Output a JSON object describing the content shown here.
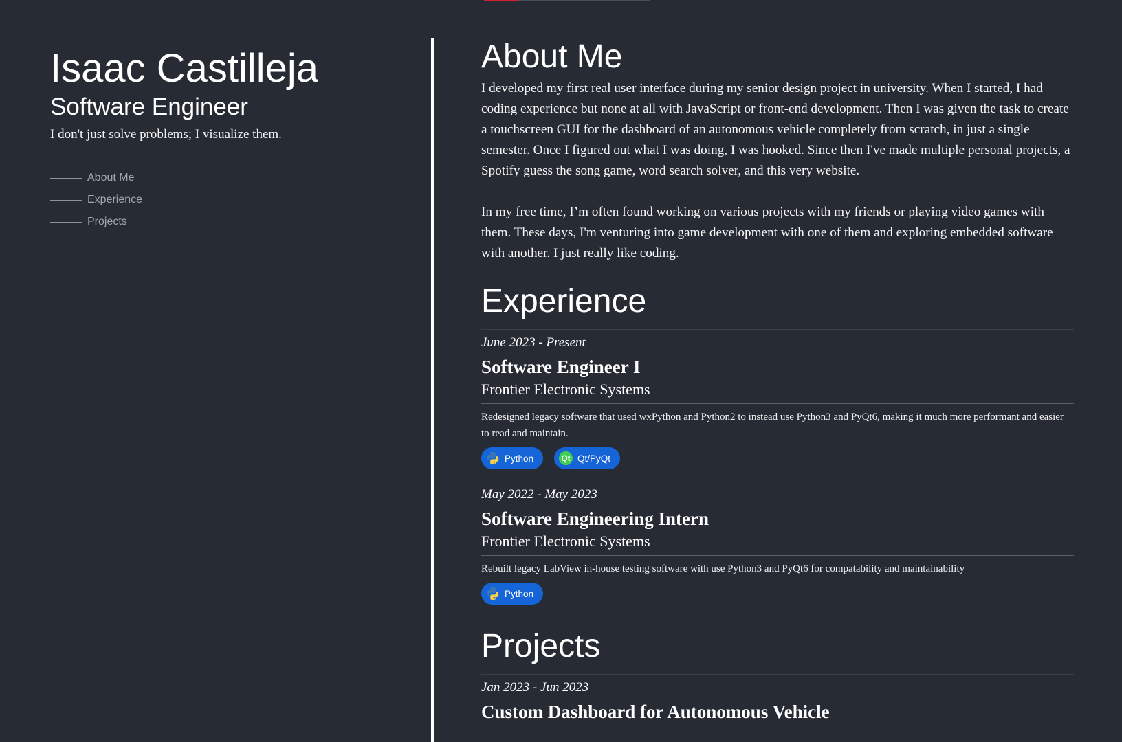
{
  "profile": {
    "name": "Isaac Castilleja",
    "role": "Software Engineer",
    "tagline": "I don't just solve problems; I visualize them."
  },
  "nav": {
    "items": [
      {
        "label": "About Me"
      },
      {
        "label": "Experience"
      },
      {
        "label": "Projects"
      }
    ]
  },
  "about": {
    "title": "About Me",
    "paragraphs": [
      "I developed my first real user interface during my senior design project in university. When I started, I had coding experience but none at all with JavaScript or front-end development. Then I was given the task to create a touchscreen GUI for the dashboard of an autonomous vehicle completely from scratch, in just a single semester. Once I figured out what I was doing, I was hooked. Since then I've made multiple personal projects, a Spotify guess the song game, word search solver, and this very website.",
      "In my free time, I’m often found working on various projects with my friends or playing video games with them. These days, I'm venturing into game development with one of them and exploring embedded software with another. I just really like coding."
    ]
  },
  "experience": {
    "title": "Experience",
    "jobs": [
      {
        "date": "June 2023 - Present",
        "title": "Software Engineer I",
        "company": "Frontier Electronic Systems",
        "description": "Redesigned legacy software that used wxPython and Python2 to instead use Python3 and PyQt6, making it much more performant and easier to read and maintain.",
        "badges": [
          {
            "label": "Python",
            "icon": "python-icon"
          },
          {
            "label": "Qt/PyQt",
            "icon": "qt-icon"
          }
        ]
      },
      {
        "date": "May 2022 - May 2023",
        "title": "Software Engineering Intern",
        "company": "Frontier Electronic Systems",
        "description": "Rebuilt legacy LabView in-house testing software with use Python3 and PyQt6 for compatability and maintainability",
        "badges": [
          {
            "label": "Python",
            "icon": "python-icon"
          }
        ]
      }
    ]
  },
  "projects": {
    "title": "Projects",
    "items": [
      {
        "date": "Jan 2023 - Jun 2023",
        "title": "Custom Dashboard for Autonomous Vehicle"
      }
    ]
  },
  "colors": {
    "background": "#272b34",
    "badge": "#1565d8",
    "accent": "#d4202f"
  }
}
